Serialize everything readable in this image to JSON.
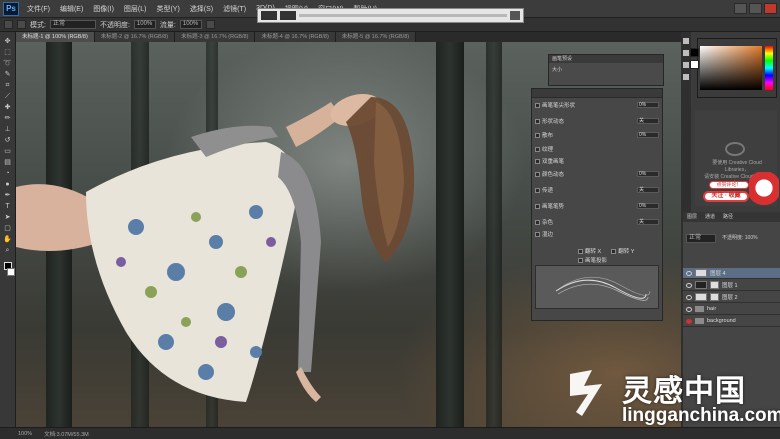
{
  "app": {
    "logo": "Ps",
    "accent": "#5fb0ff"
  },
  "menu": [
    "文件(F)",
    "编辑(E)",
    "图像(I)",
    "图层(L)",
    "类型(Y)",
    "选择(S)",
    "滤镜(T)",
    "3D(D)",
    "视图(V)",
    "窗口(W)",
    "帮助(H)"
  ],
  "options": {
    "mode_label": "模式:",
    "mode_value": "正常",
    "opacity_label": "不透明度:",
    "opacity_value": "100%",
    "flow_label": "流量:",
    "flow_value": "100%"
  },
  "tabs": [
    {
      "label": "未标题-1 @ 100% (RGB/8)",
      "active": true
    },
    {
      "label": "未标题-2 @ 16.7% (RGB/8)",
      "active": false
    },
    {
      "label": "未标题-3 @ 16.7% (RGB/8)",
      "active": false
    },
    {
      "label": "未标题-4 @ 16.7% (RGB/8)",
      "active": false
    },
    {
      "label": "未标题-5 @ 16.7% (RGB/8)",
      "active": false
    }
  ],
  "brush_panel": {
    "title": "画笔预设",
    "label": "大小"
  },
  "adjust_panel": {
    "rows": [
      {
        "label": "画笔笔尖形状",
        "value": "0%"
      },
      {
        "label": "形状动态",
        "value": "关"
      },
      {
        "label": "散布",
        "value": "0%"
      },
      {
        "label": "纹理",
        "value": ""
      },
      {
        "label": "双重画笔",
        "value": ""
      },
      {
        "label": "颜色动态",
        "value": "0%"
      },
      {
        "label": "传递",
        "value": "关"
      },
      {
        "label": "画笔笔势",
        "value": "0%"
      },
      {
        "label": "杂色",
        "value": "关"
      },
      {
        "label": "湿边",
        "value": ""
      }
    ],
    "flip_x": "翻转 X",
    "flip_y": "翻转 Y",
    "preview_label": "画笔投影"
  },
  "library": {
    "line1": "要使用 Creative Cloud Libraries，",
    "line2": "请安装 Creative Cloud 应用程序。",
    "bubble": "点赞评论！",
    "sticker": "关注 · 收藏"
  },
  "layers_panel": {
    "tabs": [
      "图层",
      "通道",
      "路径"
    ],
    "blend": "正常",
    "opacity": "不透明度: 100%",
    "layers": [
      {
        "name": "图层 4",
        "visible": true,
        "selected": true,
        "kind": "thumb"
      },
      {
        "name": "图层 1",
        "visible": true,
        "selected": false,
        "kind": "mask"
      },
      {
        "name": "图层 2",
        "visible": true,
        "selected": false,
        "kind": "mask"
      },
      {
        "name": "hair",
        "visible": true,
        "selected": false,
        "kind": "folder"
      },
      {
        "name": "background",
        "visible": false,
        "selected": false,
        "kind": "folder"
      }
    ]
  },
  "status": {
    "zoom": "100%",
    "doc": "文档:3.07M/55.3M"
  },
  "watermark": {
    "cn": "灵感中国",
    "en": "lingganchina.com"
  }
}
